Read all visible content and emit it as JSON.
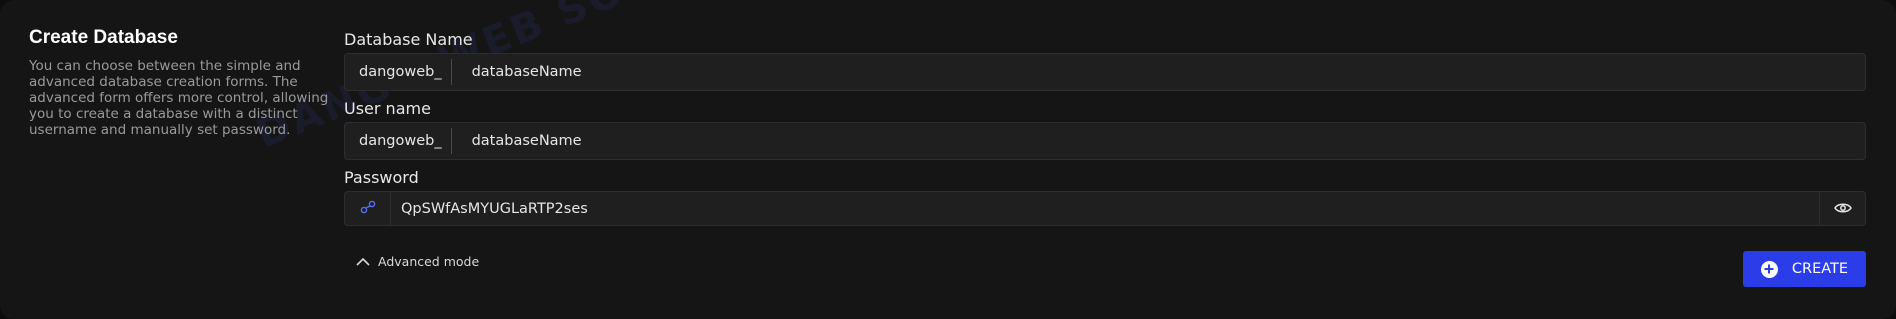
{
  "section": {
    "title": "Create Database",
    "description": "You can choose between the simple and advanced database creation forms. The advanced form offers more control, allowing you to create a database with a distinct username and manually set password."
  },
  "database_name": {
    "label": "Database Name",
    "prefix": "dangoweb_",
    "value": "databaseName"
  },
  "user_name": {
    "label": "User name",
    "prefix": "dangoweb_",
    "value": "databaseName"
  },
  "password": {
    "label": "Password",
    "value": "QpSWfAsMYUGLaRTP2ses",
    "generate_icon": "key-generate-icon",
    "visibility_icon": "eye-icon"
  },
  "advanced_toggle": {
    "label": "Advanced mode",
    "icon": "chevron-up-icon"
  },
  "create_button": {
    "label": "CREATE",
    "icon": "plus-circle-icon"
  },
  "watermark": "DANGO WEB SOLUTIONS",
  "colors": {
    "background": "#151515",
    "input_bg": "#1f1f1f",
    "accent": "#2a3de8",
    "text": "#e6e6e6",
    "muted": "#9a9a9a"
  }
}
